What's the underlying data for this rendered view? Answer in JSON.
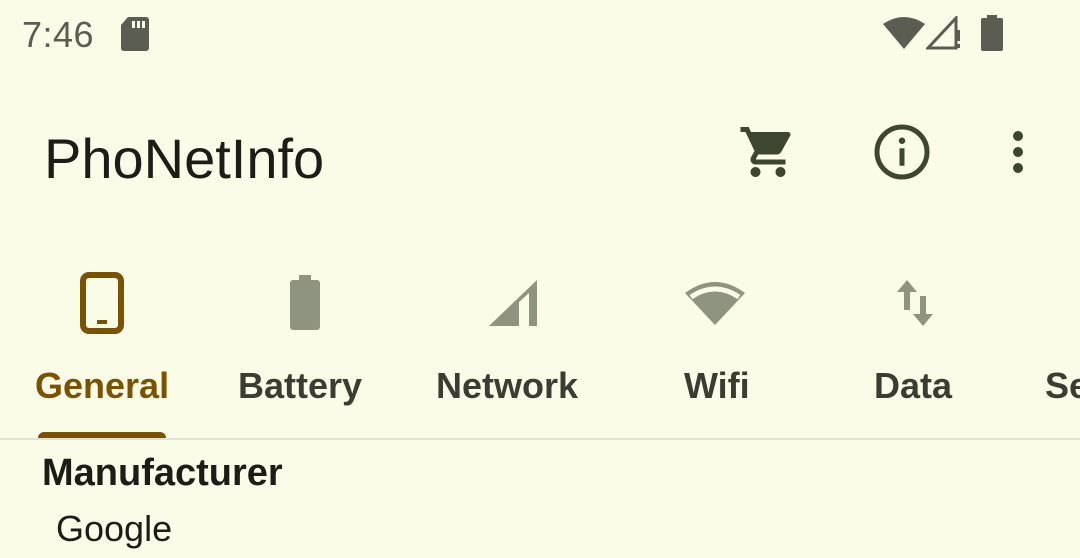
{
  "status_bar": {
    "time": "7:46",
    "icons": [
      "sd-card-icon",
      "wifi-icon",
      "signal-no-data-icon",
      "battery-icon"
    ]
  },
  "app_bar": {
    "title": "PhoNetInfo",
    "actions": [
      "cart-icon",
      "info-icon",
      "more-vert-icon"
    ]
  },
  "tabs": {
    "items": [
      {
        "label": "General",
        "icon": "phone-icon",
        "active": true
      },
      {
        "label": "Battery",
        "icon": "battery-icon",
        "active": false
      },
      {
        "label": "Network",
        "icon": "signal-icon",
        "active": false
      },
      {
        "label": "Wifi",
        "icon": "wifi-icon",
        "active": false
      },
      {
        "label": "Data",
        "icon": "swap-vert-icon",
        "active": false
      },
      {
        "label": "Se",
        "icon": "",
        "active": false
      }
    ]
  },
  "content": {
    "manufacturer_label": "Manufacturer",
    "manufacturer_value": "Google"
  },
  "colors": {
    "background": "#fafce8",
    "accent": "#7b5200",
    "tab_text": "#3b3d32",
    "tab_icon": "#8f9481",
    "title_text": "#1c1d17"
  }
}
